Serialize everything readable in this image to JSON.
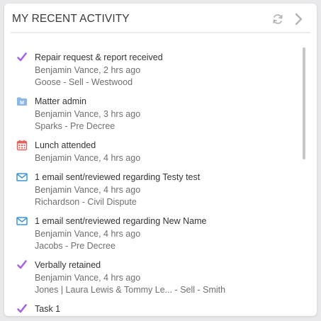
{
  "header": {
    "title": "MY RECENT ACTIVITY",
    "refresh_icon": "refresh-icon",
    "next_icon": "chevron-right-icon"
  },
  "activities": [
    {
      "icon": "check-icon",
      "title": "Repair request & report received",
      "by": "Benjamin Vance, 2 hrs ago",
      "matter": "Goose - Sell - Westwood"
    },
    {
      "icon": "folder-icon",
      "title": "Matter admin",
      "by": "Benjamin Vance, 3 hrs ago",
      "matter": "Sparks - Pre Decree"
    },
    {
      "icon": "calendar-icon",
      "title": "Lunch attended",
      "by": "Benjamin Vance, 4 hrs ago"
    },
    {
      "icon": "email-icon",
      "title": "1 email sent/reviewed regarding Testy test",
      "by": "Benjamin Vance, 4 hrs ago",
      "matter": "Richardson - Civil Dispute"
    },
    {
      "icon": "email-icon",
      "title": "1 email sent/reviewed regarding New Name",
      "by": "Benjamin Vance, 4 hrs ago",
      "matter": "Jacobs - Pre Decree"
    },
    {
      "icon": "check-icon",
      "title": "Verbally retained",
      "by": "Benjamin Vance, 4 hrs ago",
      "matter": "Jones | Laura Lewis & Tommy Le... - Sell - Smith"
    },
    {
      "icon": "check-icon",
      "title": "Task 1"
    }
  ],
  "colors": {
    "check": "#a463e6",
    "folder": "#8ab6e8",
    "calendar": "#e2615c",
    "email": "#3a95d8"
  }
}
